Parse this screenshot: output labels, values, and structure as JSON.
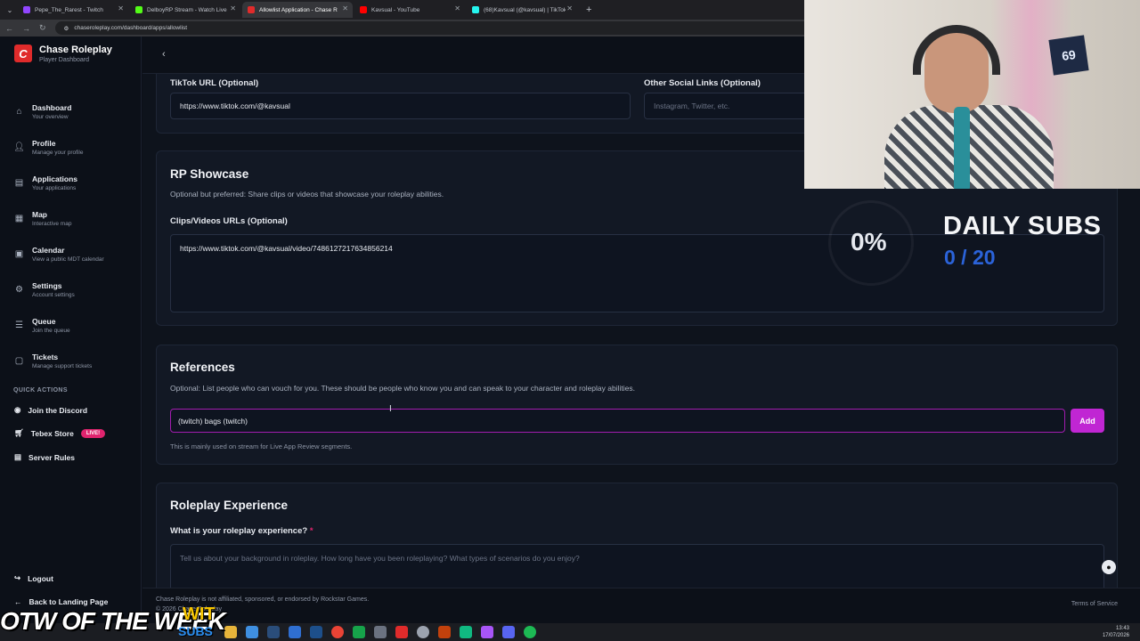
{
  "browser": {
    "tabs": [
      {
        "label": "Pepe_The_Rarest - Twitch",
        "color": "#9146ff",
        "active": false
      },
      {
        "label": "DelboyRP Stream - Watch Live",
        "color": "#53fc18",
        "active": false
      },
      {
        "label": "Allowlist Application - Chase R",
        "color": "#e02b2b",
        "active": true
      },
      {
        "label": "Kavsual - YouTube",
        "color": "#ff0000",
        "active": false
      },
      {
        "label": "(68)Kavsual (@kavsual) | TikTok",
        "color": "#25f4ee",
        "active": false
      }
    ],
    "url": "chaseroleplay.com/dashboard/apps/allowlist"
  },
  "brand": {
    "logo_letter": "C",
    "title": "Chase Roleplay",
    "subtitle": "Player Dashboard"
  },
  "nav": [
    {
      "title": "Dashboard",
      "sub": "Your overview",
      "icon": "home-icon"
    },
    {
      "title": "Profile",
      "sub": "Manage your profile",
      "icon": "user-icon"
    },
    {
      "title": "Applications",
      "sub": "Your applications",
      "icon": "document-icon"
    },
    {
      "title": "Map",
      "sub": "Interactive map",
      "icon": "map-icon"
    },
    {
      "title": "Calendar",
      "sub": "View a public MDT calendar",
      "icon": "calendar-icon"
    },
    {
      "title": "Settings",
      "sub": "Account settings",
      "icon": "gear-icon"
    },
    {
      "title": "Queue",
      "sub": "Join the queue",
      "icon": "list-icon"
    },
    {
      "title": "Tickets",
      "sub": "Manage support tickets",
      "icon": "ticket-icon"
    }
  ],
  "quick_actions": {
    "title": "QUICK ACTIONS",
    "discord": "Join the Discord",
    "tebex": "Tebex Store",
    "live_badge": "LIVE!",
    "rules": "Server Rules"
  },
  "sidebar_bottom": {
    "logout": "Logout",
    "back": "Back to Landing Page"
  },
  "social": {
    "tiktok_label": "TikTok URL (Optional)",
    "tiktok_value": "https://www.tiktok.com/@kavsual",
    "other_label": "Other Social Links (Optional)",
    "other_placeholder": "Instagram, Twitter, etc."
  },
  "showcase": {
    "title": "RP Showcase",
    "desc": "Optional but preferred: Share clips or videos that showcase your roleplay abilities.",
    "clips_label": "Clips/Videos URLs (Optional)",
    "clips_value": "https://www.tiktok.com/@kavsual/video/7486127217634856214"
  },
  "references": {
    "title": "References",
    "desc": "Optional: List people who can vouch for you. These should be people who know you and can speak to your character and roleplay abilities.",
    "input_value": "(twitch) bags (twitch)",
    "add_label": "Add",
    "hint": "This is mainly used on stream for Live App Review segments."
  },
  "experience": {
    "title": "Roleplay Experience",
    "question": "What is your roleplay experience?",
    "required_mark": "*",
    "placeholder": "Tell us about your background in roleplay. How long have you been roleplaying? What types of scenarios do you enjoy?"
  },
  "footer": {
    "disclaimer": "Chase Roleplay is not affiliated, sponsored, or endorsed by Rockstar Games.",
    "copyright": "© 2026 Chase Roleplay",
    "terms": "Terms of Service"
  },
  "overlay": {
    "subs_percent": "0%",
    "subs_title": "DAILY SUBS",
    "subs_count": "0 / 20",
    "banner": "OTW OF THE WEEK",
    "banner_badge_top": "WIT",
    "banner_badge_bottom": "SUBS",
    "webcam_sign": "69"
  },
  "taskbar": {
    "time": "13:43",
    "date": "17/07/2026"
  }
}
